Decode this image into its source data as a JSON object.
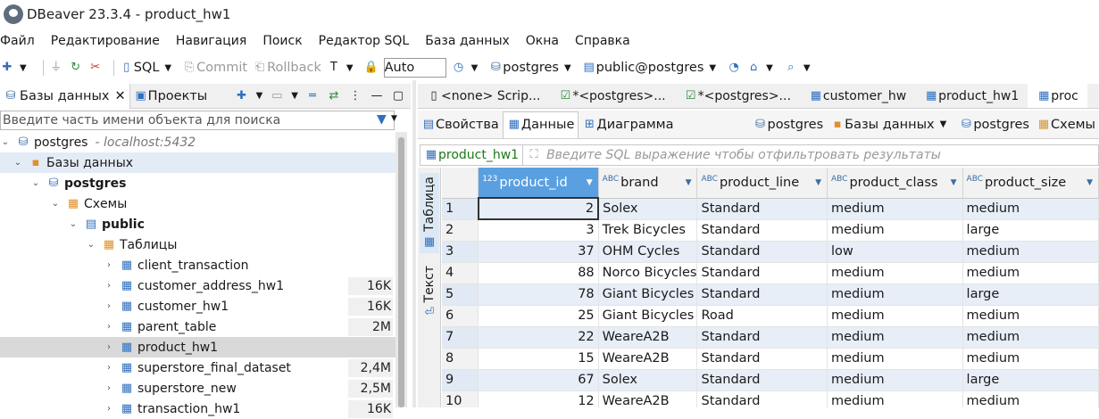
{
  "window": {
    "title": "DBeaver 23.3.4 - product_hw1"
  },
  "menu": [
    "Файл",
    "Редактирование",
    "Навигация",
    "Поиск",
    "Редактор SQL",
    "База данных",
    "Окна",
    "Справка"
  ],
  "toolbar": {
    "sql": "SQL",
    "commit": "Commit",
    "rollback": "Rollback",
    "mode": "Auto",
    "datasource": "postgres",
    "schema": "public@postgres"
  },
  "left": {
    "tab_db": "Базы данных",
    "tab_projects": "Проекты",
    "search_placeholder": "Введите часть имени объекта для поиска",
    "tree": {
      "conn": "postgres",
      "conn_host": "- localhost:5432",
      "databases": "Базы данных",
      "db": "postgres",
      "schemas": "Схемы",
      "schema": "public",
      "tables": "Таблицы",
      "items": [
        {
          "name": "client_transaction",
          "size": ""
        },
        {
          "name": "customer_address_hw1",
          "size": "16K"
        },
        {
          "name": "customer_hw1",
          "size": "16K"
        },
        {
          "name": "parent_table",
          "size": "2M"
        },
        {
          "name": "product_hw1",
          "size": ""
        },
        {
          "name": "superstore_final_dataset",
          "size": "2,4M"
        },
        {
          "name": "superstore_new",
          "size": "2,5M"
        },
        {
          "name": "transaction_hw1",
          "size": "16K"
        }
      ]
    }
  },
  "editor_tabs": [
    "<none> Scrip...",
    "*<postgres>...",
    "*<postgres>...",
    "customer_hw",
    "product_hw1",
    "proc"
  ],
  "subtabs": {
    "props": "Свойства",
    "data": "Данные",
    "diagram": "Диаграмма",
    "conn": "postgres",
    "dbs": "Базы данных",
    "db": "postgres",
    "schemas": "Схемы"
  },
  "filter": {
    "table": "product_hw1",
    "placeholder": "Введите SQL выражение чтобы отфильтровать результаты"
  },
  "vtabs": {
    "table": "Таблица",
    "text": "Текст"
  },
  "grid": {
    "columns": [
      {
        "type": "123",
        "name": "product_id"
      },
      {
        "type": "ABC",
        "name": "brand"
      },
      {
        "type": "ABC",
        "name": "product_line"
      },
      {
        "type": "ABC",
        "name": "product_class"
      },
      {
        "type": "ABC",
        "name": "product_size"
      }
    ],
    "rows": [
      [
        "1",
        "2",
        "Solex",
        "Standard",
        "medium",
        "medium"
      ],
      [
        "2",
        "3",
        "Trek Bicycles",
        "Standard",
        "medium",
        "large"
      ],
      [
        "3",
        "37",
        "OHM Cycles",
        "Standard",
        "low",
        "medium"
      ],
      [
        "4",
        "88",
        "Norco Bicycles",
        "Standard",
        "medium",
        "medium"
      ],
      [
        "5",
        "78",
        "Giant Bicycles",
        "Standard",
        "medium",
        "large"
      ],
      [
        "6",
        "25",
        "Giant Bicycles",
        "Road",
        "medium",
        "medium"
      ],
      [
        "7",
        "22",
        "WeareA2B",
        "Standard",
        "medium",
        "medium"
      ],
      [
        "8",
        "15",
        "WeareA2B",
        "Standard",
        "medium",
        "medium"
      ],
      [
        "9",
        "67",
        "Solex",
        "Standard",
        "medium",
        "large"
      ],
      [
        "10",
        "12",
        "WeareA2B",
        "Standard",
        "medium",
        "medium"
      ]
    ]
  }
}
